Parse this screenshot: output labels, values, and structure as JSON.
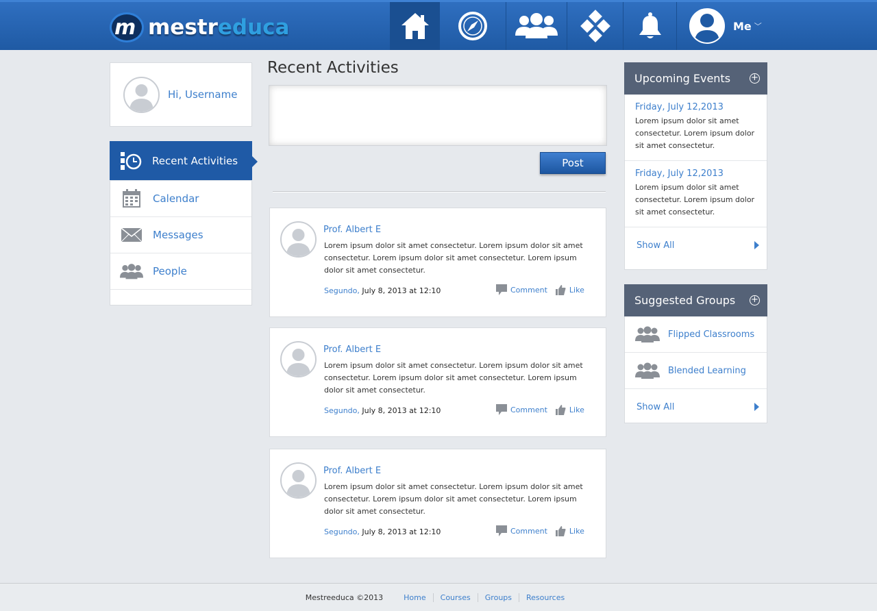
{
  "brand": {
    "logo_glyph": "m",
    "name_part1": "mestr",
    "name_part2": "educa",
    "colors": {
      "topbar": "#1f5aa4",
      "accent": "#3d7fcc",
      "sidebar_header": "#556277"
    }
  },
  "nav": {
    "items": [
      {
        "icon": "home-icon",
        "active": true
      },
      {
        "icon": "compass-icon",
        "active": false
      },
      {
        "icon": "users-icon",
        "active": false
      },
      {
        "icon": "apps-diamond-icon",
        "active": false
      },
      {
        "icon": "bell-icon",
        "active": false
      }
    ],
    "me_label": "Me",
    "me_caret": "﹀"
  },
  "profile": {
    "greeting": "Hi, Username"
  },
  "menu": {
    "items": [
      {
        "label": "Recent Activities",
        "icon": "activity-clock-icon",
        "active": true
      },
      {
        "label": "Calendar",
        "icon": "calendar-icon",
        "active": false
      },
      {
        "label": "Messages",
        "icon": "envelope-icon",
        "active": false
      },
      {
        "label": "People",
        "icon": "people-icon",
        "active": false
      }
    ]
  },
  "main": {
    "title": "Recent Activities",
    "post_placeholder": "",
    "post_button": "Post",
    "activities": [
      {
        "author": "Prof. Albert E",
        "text": "Lorem ipsum dolor sit amet consectetur. Lorem ipsum dolor sit amet consectetur. Lorem ipsum dolor sit amet consectetur. Lorem ipsum dolor sit amet consectetur.",
        "by": "Segundo,",
        "time": "July 8, 2013 at 12:10",
        "comment_label": "Comment",
        "like_label": "Like"
      },
      {
        "author": "Prof. Albert E",
        "text": "Lorem ipsum dolor sit amet consectetur. Lorem ipsum dolor sit amet consectetur. Lorem ipsum dolor sit amet consectetur. Lorem ipsum dolor sit amet consectetur.",
        "by": "Segundo,",
        "time": "July 8, 2013 at 12:10",
        "comment_label": "Comment",
        "like_label": "Like"
      },
      {
        "author": "Prof. Albert E",
        "text": "Lorem ipsum dolor sit amet consectetur. Lorem ipsum dolor sit amet consectetur. Lorem ipsum dolor sit amet consectetur. Lorem ipsum dolor sit amet consectetur.",
        "by": "Segundo,",
        "time": "July 8, 2013 at 12:10",
        "comment_label": "Comment",
        "like_label": "Like"
      }
    ]
  },
  "events": {
    "title": "Upcoming Events",
    "plus": "+",
    "items": [
      {
        "date": "Friday, July 12,2013",
        "text": "Lorem ipsum dolor sit amet consectetur. Lorem ipsum dolor sit amet consectetur."
      },
      {
        "date": "Friday, July 12,2013",
        "text": "Lorem ipsum dolor sit amet consectetur. Lorem ipsum dolor sit amet consectetur."
      }
    ],
    "show_all": "Show All"
  },
  "groups": {
    "title": "Suggested Groups",
    "plus": "+",
    "items": [
      {
        "name": "Flipped Classrooms",
        "icon": "group-icon"
      },
      {
        "name": "Blended Learning",
        "icon": "group-icon"
      }
    ],
    "show_all": "Show All"
  },
  "footer": {
    "copyright": "Mestreeduca ©2013",
    "links": [
      "Home",
      "Courses",
      "Groups",
      "Resources"
    ]
  }
}
